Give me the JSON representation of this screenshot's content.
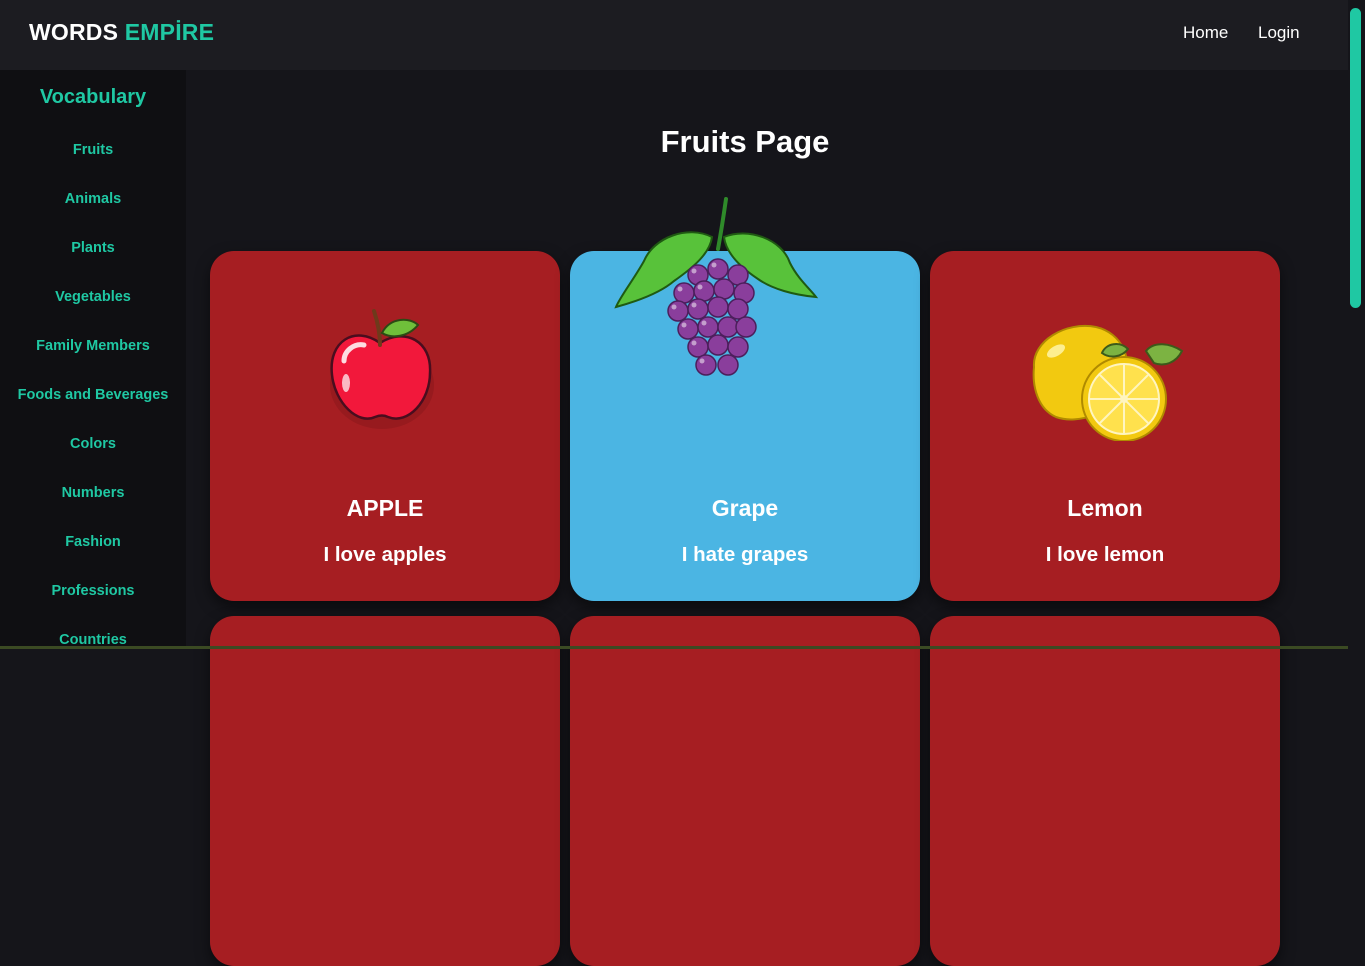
{
  "logo": {
    "part1": "WORDS",
    "part2": "EMPİRE"
  },
  "nav": {
    "home": "Home",
    "login": "Login"
  },
  "sidebar": {
    "title": "Vocabulary",
    "items": [
      {
        "label": "Fruits"
      },
      {
        "label": "Animals"
      },
      {
        "label": "Plants"
      },
      {
        "label": "Vegetables"
      },
      {
        "label": "Family Members"
      },
      {
        "label": "Foods and Beverages"
      },
      {
        "label": "Colors"
      },
      {
        "label": "Numbers"
      },
      {
        "label": "Fashion"
      },
      {
        "label": "Professions"
      },
      {
        "label": "Countries"
      }
    ]
  },
  "main": {
    "title": "Fruits Page",
    "cards": [
      {
        "name": "APPLE",
        "desc": "I love apples",
        "color": "#a61e22",
        "icon": "apple-icon"
      },
      {
        "name": "Grape",
        "desc": "I hate grapes",
        "color": "#4bb5e3",
        "icon": "grape-icon"
      },
      {
        "name": "Lemon",
        "desc": "I love lemon",
        "color": "#a61e22",
        "icon": "lemon-icon"
      },
      {
        "name": "",
        "desc": "",
        "color": "#a61e22"
      },
      {
        "name": "",
        "desc": "",
        "color": "#a61e22"
      },
      {
        "name": "",
        "desc": "",
        "color": "#a61e22"
      }
    ]
  },
  "colors": {
    "accent": "#1fc8a3",
    "background": "#15151a",
    "navbar": "#1c1c21",
    "sidebar": "#0f0f12"
  }
}
